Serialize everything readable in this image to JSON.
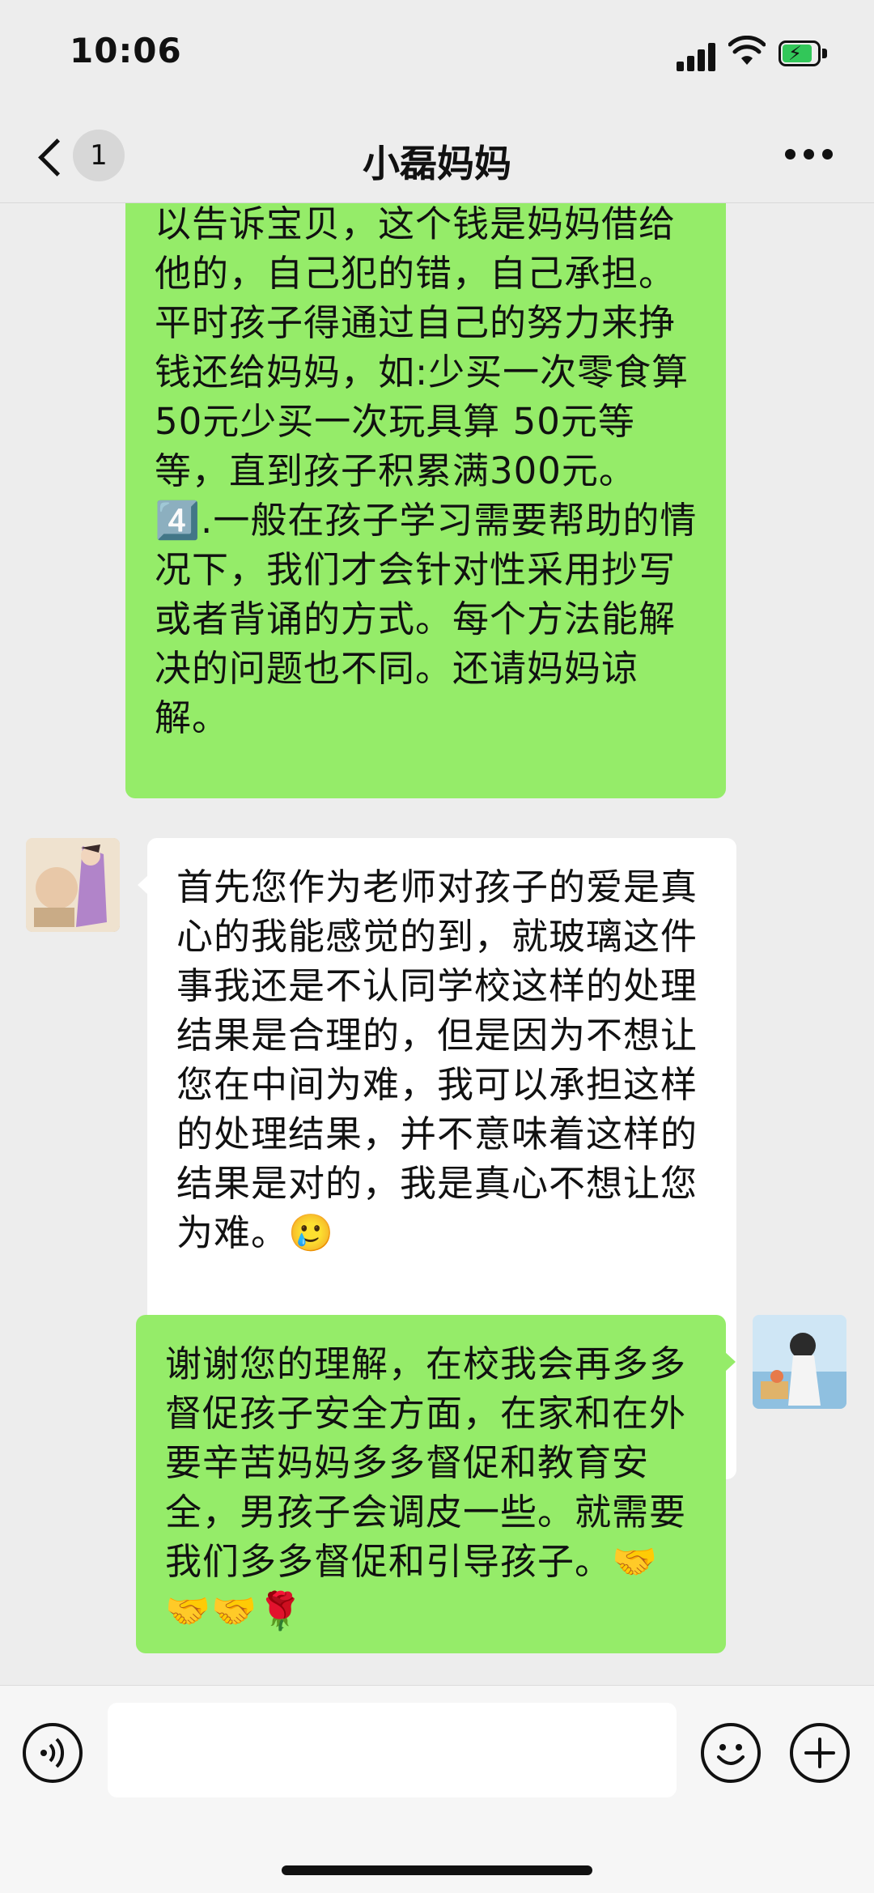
{
  "status_bar": {
    "time": "10:06"
  },
  "header": {
    "unread_count": "1",
    "title": "小磊妈妈"
  },
  "messages": [
    {
      "sender": "self",
      "text": "以告诉宝贝，这个钱是妈妈借给他的，自己犯的错，自己承担。平时孩子得通过自己的努力来挣钱还给妈妈，如:少买一次零食算 50元少买一次玩具算 50元等等，直到孩子积累满300元。\n4️⃣.一般在孩子学习需要帮助的情况下，我们才会针对性采用抄写或者背诵的方式。每个方法能解决的问题也不同。还请妈妈谅解。"
    },
    {
      "sender": "other",
      "text": "首先您作为老师对孩子的爱是真心的我能感觉的到，就玻璃这件事我还是不认同学校这样的处理结果是合理的，但是因为不想让您在中间为难，我可以承担这样的处理结果，并不意味着这样的结果是对的，我是真心不想让您为难。🥲"
    },
    {
      "sender": "self",
      "text": "谢谢您的理解，在校我会再多多督促孩子安全方面，在家和在外要辛苦妈妈多多督促和教育安全，男孩子会调皮一些。就需要我们多多督促和引导孩子。🤝🤝🤝🌹"
    }
  ],
  "input_bar": {
    "placeholder": ""
  },
  "colors": {
    "self_bubble": "#95ec69",
    "other_bubble": "#ffffff",
    "background": "#ededed"
  }
}
